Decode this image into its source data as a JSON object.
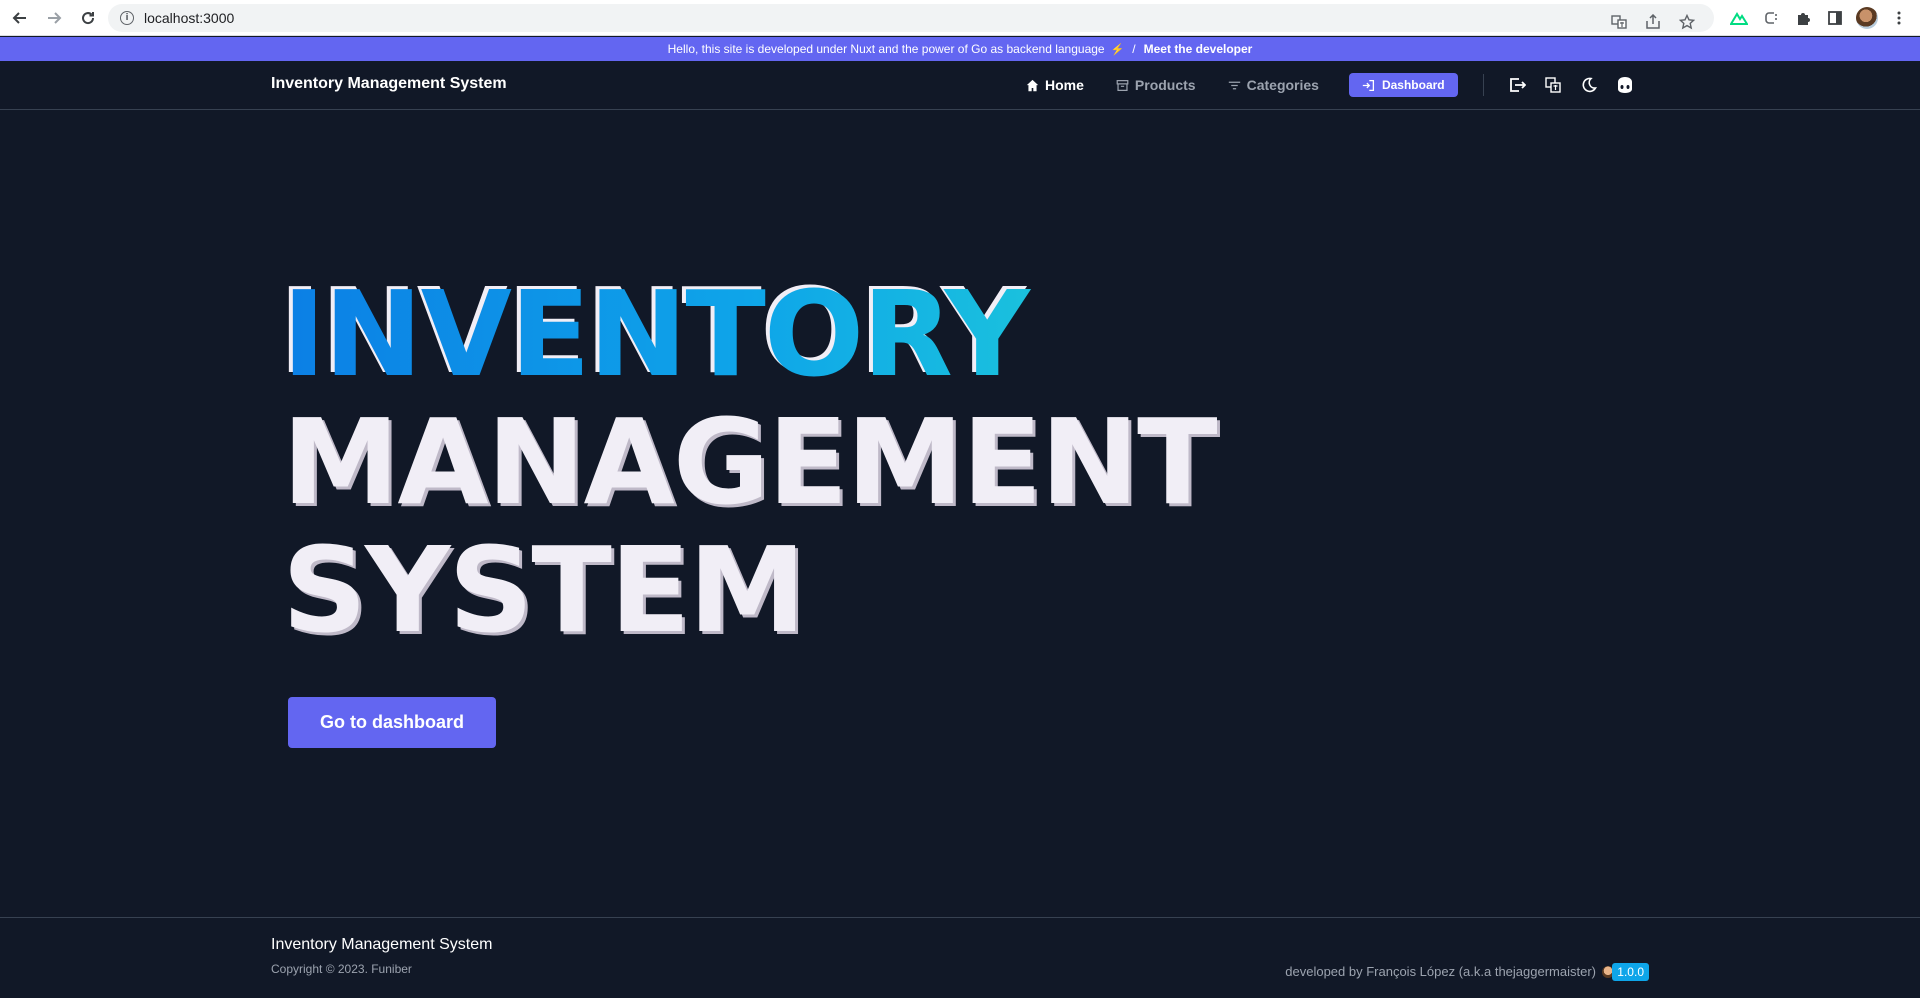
{
  "browser": {
    "url": "localhost:3000"
  },
  "announcement": {
    "text": "Hello, this site is developed under Nuxt and the power of Go as backend language",
    "separator": "/",
    "link": "Meet the developer"
  },
  "header": {
    "brand": "Inventory Management System",
    "nav": {
      "home": "Home",
      "products": "Products",
      "categories": "Categories",
      "dashboard": "Dashboard"
    }
  },
  "hero": {
    "line1": "INVENTORY",
    "line2": "MANAGEMENT",
    "line3": "SYSTEM",
    "cta": "Go to dashboard"
  },
  "footer": {
    "title": "Inventory Management System",
    "copyright": "Copyright © 2023. Funiber",
    "developer": "developed by François López (a.k.a thejaggermaister)",
    "version": "1.0.0"
  },
  "colors": {
    "background": "#111827",
    "accent": "#6366f1",
    "badge": "#0ea5e9"
  },
  "icons": [
    "back-arrow-icon",
    "forward-arrow-icon",
    "reload-icon",
    "info-icon",
    "translate-icon",
    "share-icon",
    "star-icon",
    "nuxt-icon",
    "extension-icon",
    "puzzle-icon",
    "sidebar-icon",
    "menu-icon",
    "home-icon",
    "archive-icon",
    "filter-icon",
    "login-icon",
    "logout-icon",
    "language-icon",
    "moon-icon",
    "github-icon"
  ]
}
